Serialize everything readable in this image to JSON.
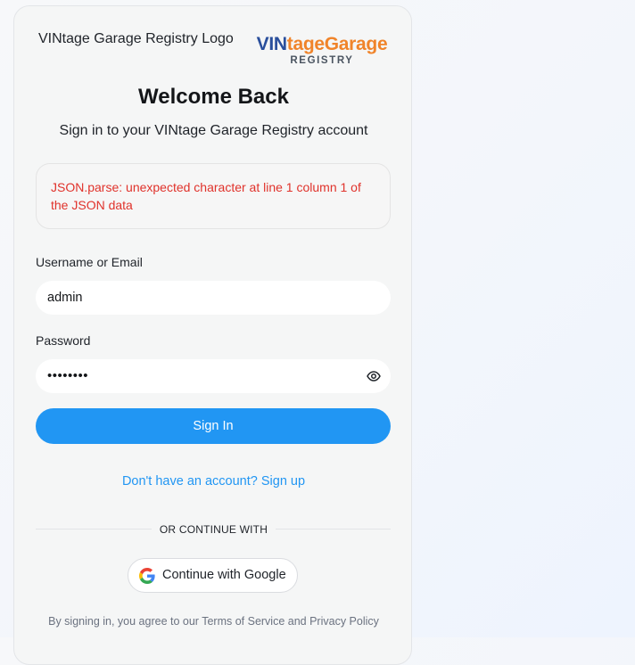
{
  "header": {
    "logo_alt": "VINtage Garage Registry Logo",
    "brand_vin": "VIN",
    "brand_rest": "tageGarage",
    "brand_sub": "REGISTRY"
  },
  "title": "Welcome Back",
  "subtitle": "Sign in to your VINtage Garage Registry account",
  "error": "JSON.parse: unexpected character at line 1 column 1 of the JSON data",
  "form": {
    "username_label": "Username or Email",
    "username_value": "admin",
    "password_label": "Password",
    "password_masked": "••••••••",
    "signin_label": "Sign In"
  },
  "signup_link": "Don't have an account? Sign up",
  "divider_text": "OR CONTINUE WITH",
  "google_label": "Continue with Google",
  "terms": "By signing in, you agree to our Terms of Service and Privacy Policy",
  "colors": {
    "accent": "#2196f3",
    "error": "#e0322b",
    "brand_blue": "#2a4f9c",
    "brand_orange": "#f0842a"
  },
  "icons": {
    "password_toggle": "eye-icon",
    "google": "google-g-icon"
  }
}
